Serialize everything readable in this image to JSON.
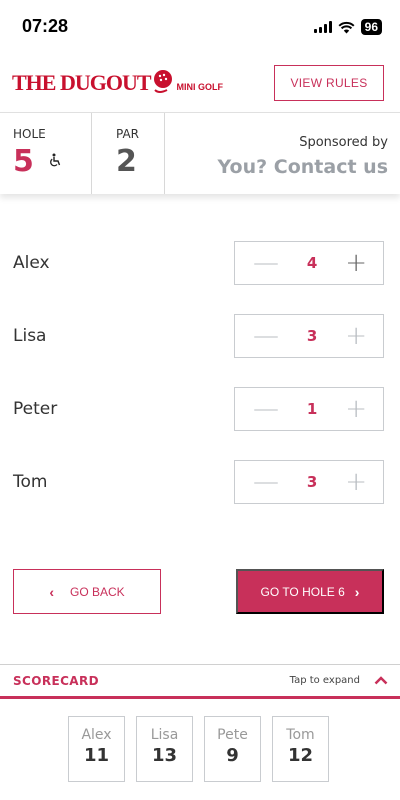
{
  "status_bar": {
    "time": "07:28",
    "battery": "96"
  },
  "header": {
    "logo_main": "The Dugout",
    "logo_sub": "MINI GOLF",
    "view_rules_label": "VIEW RULES"
  },
  "hole_info": {
    "hole_label": "HOLE",
    "hole_number": "5",
    "par_label": "PAR",
    "par_value": "2",
    "sponsored_by": "Sponsored by",
    "sponsor_contact": "You? Contact us"
  },
  "players": [
    {
      "name": "Alex",
      "score": "4"
    },
    {
      "name": "Lisa",
      "score": "3"
    },
    {
      "name": "Peter",
      "score": "1"
    },
    {
      "name": "Tom",
      "score": "3"
    }
  ],
  "nav": {
    "back_label": "GO BACK",
    "next_label": "GO TO HOLE 6"
  },
  "scorecard": {
    "title": "SCORECARD",
    "tap_hint": "Tap to expand",
    "totals": [
      {
        "name": "Alex",
        "total": "11"
      },
      {
        "name": "Lisa",
        "total": "13"
      },
      {
        "name": "Pete",
        "total": "9"
      },
      {
        "name": "Tom",
        "total": "12"
      }
    ]
  },
  "colors": {
    "accent": "#c8305a",
    "muted_text": "#9ba0a6"
  },
  "icons": {
    "accessibility": "wheelchair-icon",
    "back": "chevron-left-icon",
    "next": "chevron-right-icon",
    "collapse": "chevron-up-icon"
  }
}
